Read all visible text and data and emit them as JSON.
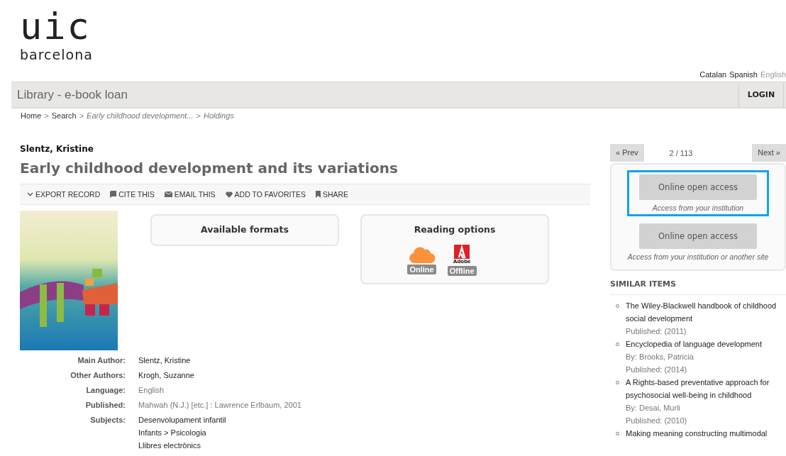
{
  "logo": {
    "mark": "uic",
    "place": "barcelona"
  },
  "languages": [
    {
      "label": "Catalan",
      "selected": false
    },
    {
      "label": "Spanish",
      "selected": false
    },
    {
      "label": "English",
      "selected": true
    }
  ],
  "header": {
    "title": "Library - e-book loan",
    "login": "LOGIN"
  },
  "breadcrumb": [
    {
      "kind": "link",
      "text": "Home"
    },
    {
      "kind": "sep",
      "text": ">"
    },
    {
      "kind": "link",
      "text": "Search"
    },
    {
      "kind": "sep",
      "text": ">"
    },
    {
      "kind": "current",
      "text": "Early childhood development..."
    },
    {
      "kind": "sep",
      "text": ">"
    },
    {
      "kind": "current",
      "text": "Holdings"
    }
  ],
  "record": {
    "author": "Slentz, Kristine",
    "title": "Early childhood development and its variations"
  },
  "actions": [
    {
      "kind": "export",
      "label": "EXPORT RECORD"
    },
    {
      "kind": "cite",
      "label": "CITE THIS"
    },
    {
      "kind": "email",
      "label": "EMAIL THIS"
    },
    {
      "kind": "favorite",
      "label": "ADD TO FAVORITES"
    },
    {
      "kind": "share",
      "label": "SHARE"
    }
  ],
  "available_formats": {
    "title": "Available formats"
  },
  "reading_options": {
    "title": "Reading options",
    "options": [
      {
        "kind": "cloud",
        "label": "Online"
      },
      {
        "kind": "adobe",
        "label": "Offline",
        "logo_text": "Adobe"
      }
    ]
  },
  "details": [
    {
      "label": "Main Author:",
      "kind": "link",
      "values": [
        "Slentz, Kristine"
      ]
    },
    {
      "label": "Other Authors:",
      "kind": "link",
      "values": [
        "Krogh, Suzanne"
      ]
    },
    {
      "label": "Language:",
      "kind": "plain",
      "values": [
        "English"
      ]
    },
    {
      "label": "Published:",
      "kind": "plain",
      "values": [
        "Mahwah (N.J.) [etc.] : Lawrence Erlbaum, 2001"
      ]
    },
    {
      "label": "Subjects:",
      "kind": "link",
      "values": [
        "Desenvolupament infantil",
        "Infants > Psicologia",
        "Llibres electrònics"
      ]
    }
  ],
  "pager": {
    "prev": "« Prev",
    "position": "2 / 113",
    "next": "Next »"
  },
  "access_options": [
    {
      "button": "Online open access",
      "note": "Access from your institution",
      "highlighted": true
    },
    {
      "button": "Online open access",
      "note": "Access from your institution or another site",
      "highlighted": false
    }
  ],
  "similar_items": {
    "heading": "SIMILAR ITEMS",
    "items": [
      {
        "title": "The Wiley-Blackwell handbook of childhood social development",
        "lines": [
          "Published: (2011)"
        ]
      },
      {
        "title": "Encyclopedia of language development",
        "lines": [
          "By: Brooks, Patricia",
          "Published: (2014)"
        ]
      },
      {
        "title": "A Rights-based preventative approach for psychosocial well-being in childhood",
        "lines": [
          "By: Desai, Murli",
          "Published: (2010)"
        ]
      },
      {
        "title": "Making meaning constructing multimodal"
      }
    ]
  }
}
